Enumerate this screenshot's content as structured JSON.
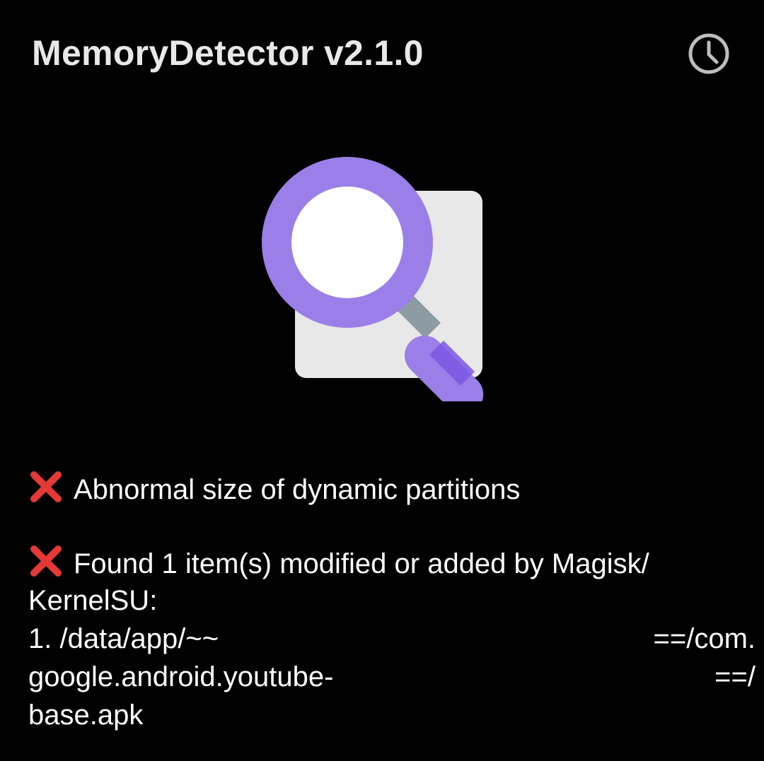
{
  "app_bar": {
    "title": "MemoryDetector v2.1.0",
    "history_icon": "clock-icon"
  },
  "hero": {
    "icon": "magnifier-document-icon",
    "colors": {
      "accent": "#9b7fe8",
      "accent_dark": "#7b57e4",
      "paper": "#e8e8e8",
      "handle_neck": "#8d9ba3"
    }
  },
  "results": [
    {
      "status_icon": "cross-mark-icon",
      "text": "Abnormal size of dynamic partitions"
    },
    {
      "status_icon": "cross-mark-icon",
      "line1": "Found 1 item(s) modified or added by Magisk/",
      "line2": "KernelSU:",
      "line3_left": "1. /data/app/~~",
      "line3_right": "==/com.",
      "line4_left": "google.android.youtube-",
      "line4_right": "==/",
      "line5": "base.apk"
    }
  ],
  "colors": {
    "background": "#000000",
    "text": "#ffffff",
    "error": "#e53935"
  }
}
